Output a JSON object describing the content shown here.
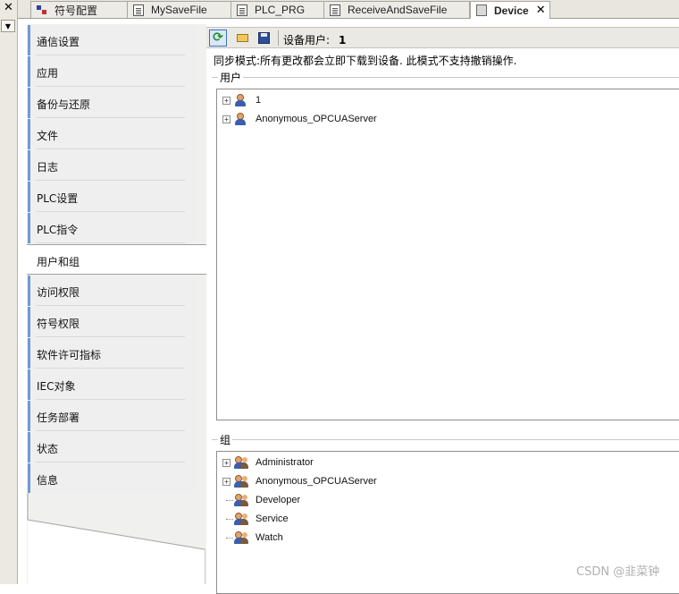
{
  "tabs": [
    {
      "label": "符号配置",
      "icon": "symbol-config-icon",
      "active": false
    },
    {
      "label": "MySaveFile",
      "icon": "document-icon",
      "active": false
    },
    {
      "label": "PLC_PRG",
      "icon": "document-icon",
      "active": false
    },
    {
      "label": "ReceiveAndSaveFile",
      "icon": "document-icon",
      "active": false
    },
    {
      "label": "Device",
      "icon": "device-icon",
      "active": true,
      "close": "✕"
    }
  ],
  "left_strip": {
    "close": "✕",
    "dropdown": "▼"
  },
  "nav": {
    "items": [
      {
        "label": "通信设置"
      },
      {
        "label": "应用"
      },
      {
        "label": "备份与还原"
      },
      {
        "label": "文件"
      },
      {
        "label": "日志"
      },
      {
        "label": "PLC设置"
      },
      {
        "label": "PLC指令"
      },
      {
        "label": "用户和组",
        "active": true
      },
      {
        "label": "访问权限"
      },
      {
        "label": "符号权限"
      },
      {
        "label": "软件许可指标"
      },
      {
        "label": "IEC对象"
      },
      {
        "label": "任务部署"
      },
      {
        "label": "状态"
      },
      {
        "label": "信息"
      }
    ]
  },
  "toolbar": {
    "refresh_icon": "⟳",
    "device_user_label": "设备用户:",
    "device_user_value": "1"
  },
  "sync_message": "同步模式:所有更改都会立即下载到设备. 此模式不支持撤销操作.",
  "users": {
    "label": "用户",
    "items": [
      {
        "name": "1",
        "expandable": true
      },
      {
        "name": "Anonymous_OPCUAServer",
        "expandable": true
      }
    ]
  },
  "groups": {
    "label": "组",
    "items": [
      {
        "name": "Administrator",
        "expandable": true
      },
      {
        "name": "Anonymous_OPCUAServer",
        "expandable": true
      },
      {
        "name": "Developer",
        "expandable": false
      },
      {
        "name": "Service",
        "expandable": false
      },
      {
        "name": "Watch",
        "expandable": false
      }
    ]
  },
  "expander_symbol": "+",
  "watermark": "CSDN @韭菜钟"
}
